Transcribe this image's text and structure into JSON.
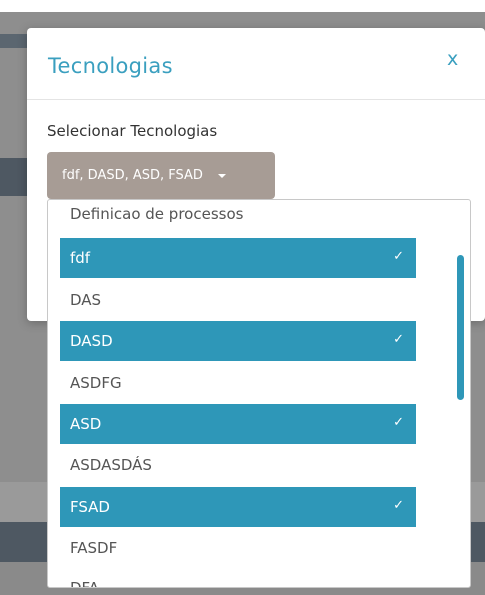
{
  "modal": {
    "title": "Tecnologias",
    "close_label": "x",
    "field_label": "Selecionar Tecnologias",
    "select_value": "fdf, DASD, ASD, FSAD"
  },
  "dropdown": {
    "options": [
      {
        "label": "Definicao de processos",
        "selected": false
      },
      {
        "label": "fdf",
        "selected": true
      },
      {
        "label": "DAS",
        "selected": false
      },
      {
        "label": "DASD",
        "selected": true
      },
      {
        "label": "ASDFG",
        "selected": false
      },
      {
        "label": "ASD",
        "selected": true
      },
      {
        "label": "ASDASDÁS",
        "selected": false
      },
      {
        "label": "FSAD",
        "selected": true
      },
      {
        "label": "FASDF",
        "selected": false
      },
      {
        "label": "DFA",
        "selected": false
      }
    ],
    "check_glyph": "✓"
  },
  "colors": {
    "accent": "#2e97b8",
    "select_bg": "#a79c95",
    "title": "#3a9fbf"
  }
}
